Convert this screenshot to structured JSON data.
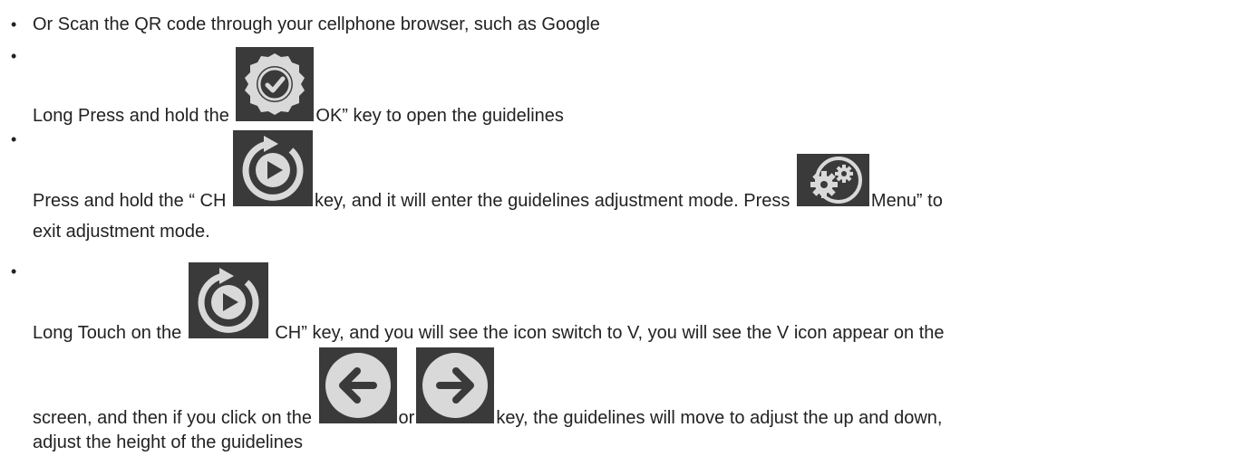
{
  "items": [
    {
      "text": "Or Scan the QR code through your cellphone browser, such as Google"
    },
    {
      "before": "Long Press and hold the ",
      "icon": "ok-check-icon",
      "after": "OK” key to open the guidelines"
    },
    {
      "before": "Press and hold the “ CH ",
      "icon": "ch-replay-icon",
      "middle": "key, and it will enter the guidelines adjustment mode. Press ",
      "icon2": "menu-gears-icon",
      "after": "Menu” to",
      "continuation": "exit adjustment mode."
    },
    {
      "before": "Long Touch on the ",
      "icon": "ch-replay-icon",
      "after": " CH” key, and you will see the icon switch to V, you will see the V icon appear on the",
      "line2_before": "screen, and then if you click on the ",
      "icon_left": "left-arrow-icon",
      "or_text": "or",
      "icon_right": "right-arrow-icon",
      "line2_after": "key, the guidelines will move to adjust the up and down,",
      "continuation": "adjust the height of the guidelines"
    }
  ],
  "colors": {
    "text": "#222222",
    "icon_bg": "#3c3c3c",
    "icon_fg": "#d9d9d9"
  }
}
